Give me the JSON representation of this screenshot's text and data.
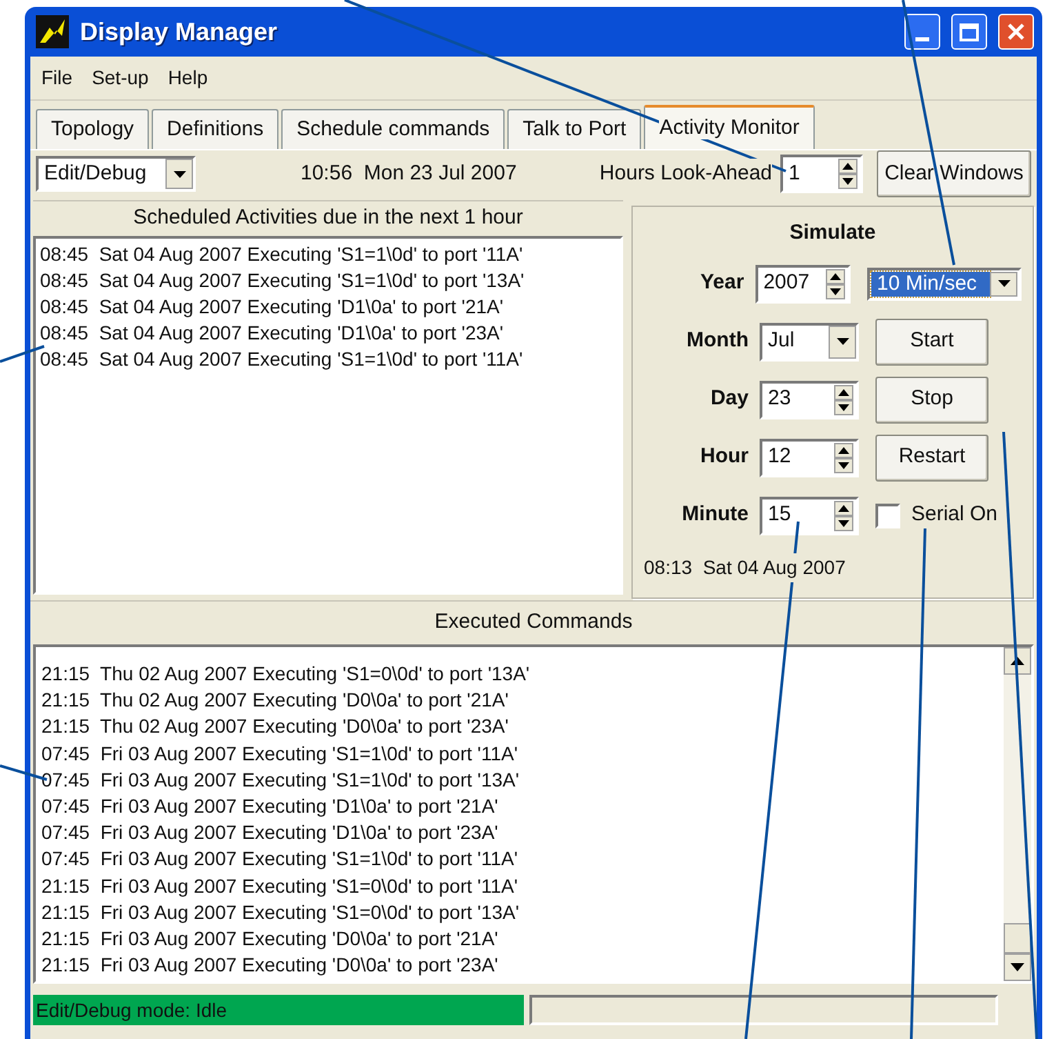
{
  "window": {
    "title": "Display Manager"
  },
  "menu": [
    "File",
    "Set-up",
    "Help"
  ],
  "tabs": [
    {
      "label": "Topology",
      "selected": false
    },
    {
      "label": "Definitions",
      "selected": false
    },
    {
      "label": "Schedule commands",
      "selected": false
    },
    {
      "label": "Talk to Port",
      "selected": false
    },
    {
      "label": "Activity Monitor",
      "selected": true
    }
  ],
  "toolbar": {
    "mode": "Edit/Debug",
    "clock": "10:56  Mon 23 Jul 2007",
    "look_ahead_label": "Hours Look-Ahead",
    "look_ahead": "1",
    "clear_button": "Clear Windows"
  },
  "scheduled": {
    "title": "Scheduled Activities due in the next 1 hour",
    "rows": [
      "08:45  Sat 04 Aug 2007 Executing 'S1=1\\0d' to port '11A'",
      "08:45  Sat 04 Aug 2007 Executing 'S1=1\\0d' to port '13A'",
      "08:45  Sat 04 Aug 2007 Executing 'D1\\0a' to port '21A'",
      "08:45  Sat 04 Aug 2007 Executing 'D1\\0a' to port '23A'",
      "08:45  Sat 04 Aug 2007 Executing 'S1=1\\0d' to port '11A'"
    ]
  },
  "simulate": {
    "title": "Simulate",
    "fields": [
      {
        "label": "Year",
        "value": "2007",
        "kind": "spin"
      },
      {
        "label": "Month",
        "value": "Jul",
        "kind": "dropdown"
      },
      {
        "label": "Day",
        "value": "23",
        "kind": "spin"
      },
      {
        "label": "Hour",
        "value": "12",
        "kind": "spin"
      },
      {
        "label": "Minute",
        "value": "15",
        "kind": "spin"
      }
    ],
    "speed": "10 Min/sec",
    "buttons": [
      "Start",
      "Stop",
      "Restart"
    ],
    "serial": {
      "label": "Serial On",
      "checked": false
    },
    "sim_time": "08:13  Sat 04 Aug 2007"
  },
  "executed": {
    "title": "Executed Commands",
    "rows": [
      "21:15  Thu 02 Aug 2007 Executing 'S1=0\\0d' to port '13A'",
      "21:15  Thu 02 Aug 2007 Executing 'D0\\0a' to port '21A'",
      "21:15  Thu 02 Aug 2007 Executing 'D0\\0a' to port '23A'",
      "07:45  Fri 03 Aug 2007 Executing 'S1=1\\0d' to port '11A'",
      "07:45  Fri 03 Aug 2007 Executing 'S1=1\\0d' to port '13A'",
      "07:45  Fri 03 Aug 2007 Executing 'D1\\0a' to port '21A'",
      "07:45  Fri 03 Aug 2007 Executing 'D1\\0a' to port '23A'",
      "07:45  Fri 03 Aug 2007 Executing 'S1=1\\0d' to port '11A'",
      "21:15  Fri 03 Aug 2007 Executing 'S1=0\\0d' to port '11A'",
      "21:15  Fri 03 Aug 2007 Executing 'S1=0\\0d' to port '13A'",
      "21:15  Fri 03 Aug 2007 Executing 'D0\\0a' to port '21A'",
      "21:15  Fri 03 Aug 2007 Executing 'D0\\0a' to port '23A'"
    ]
  },
  "status_bar": {
    "mode": "Edit/Debug mode: Idle"
  }
}
